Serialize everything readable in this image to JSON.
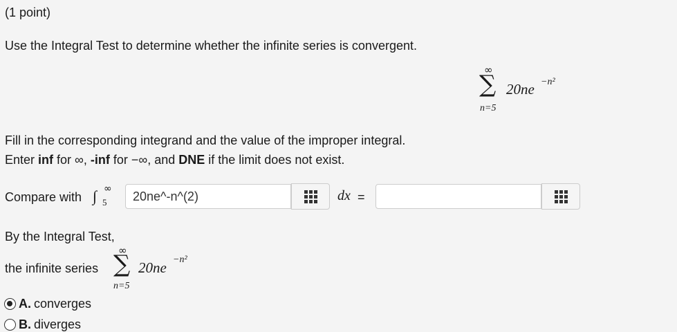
{
  "header": {
    "points": "(1 point)"
  },
  "question": {
    "text": "Use the Integral Test to determine whether the infinite series is convergent."
  },
  "series": {
    "sigma": "∑",
    "upper": "∞",
    "lower": "n=5",
    "term": "20ne",
    "exponent": "−n²"
  },
  "instructions": {
    "line1": "Fill in the corresponding integrand and the value of the improper integral.",
    "enter": "Enter ",
    "inf": "inf",
    "for_inf": " for ∞, ",
    "neg_inf": "-inf",
    "for_neg_inf": " for −∞, and ",
    "dne": "DNE",
    "tail": " if the limit does not exist."
  },
  "compare": {
    "label": "Compare with",
    "integral_sign": "∫",
    "upper": "∞",
    "lower": "5",
    "integrand_value": "20ne^-n^(2)",
    "dx": "dx",
    "equals": "=",
    "integral_value": ""
  },
  "integral_test": {
    "heading": "By the Integral Test,",
    "prefix": "the infinite series"
  },
  "options": [
    {
      "letter": "A.",
      "label": "converges",
      "selected": true
    },
    {
      "letter": "B.",
      "label": "diverges",
      "selected": false
    }
  ],
  "icons": {
    "palette": "math-palette-grid-icon"
  }
}
